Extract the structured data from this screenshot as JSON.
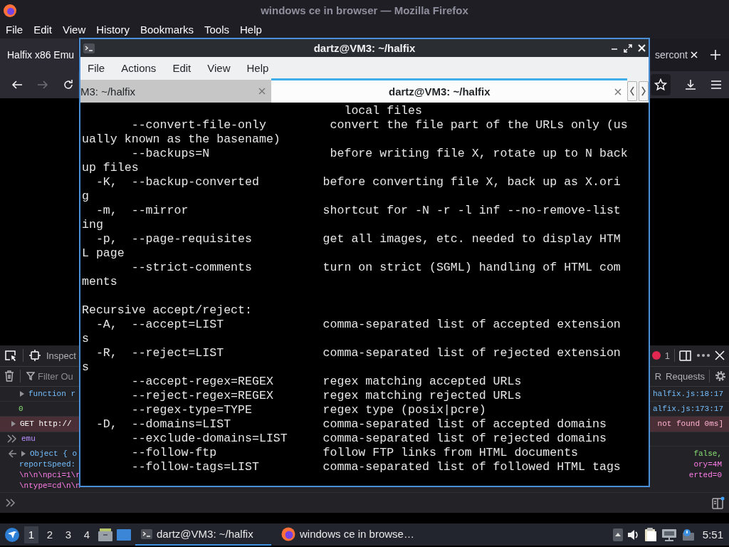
{
  "firefox": {
    "title": "windows ce in browser — Mozilla Firefox",
    "menu": [
      "File",
      "Edit",
      "View",
      "History",
      "Bookmarks",
      "Tools",
      "Help"
    ],
    "tabs": [
      {
        "label": "Halfix x86 Emu",
        "selected": true
      },
      {
        "label": "sercont",
        "selected": false
      }
    ]
  },
  "devtools": {
    "tool": "Inspect",
    "error_count": "1",
    "filter": {
      "placeholder": "Filter Ou"
    },
    "filter_tabs": [
      "R",
      "Requests"
    ],
    "console": [
      {
        "kind": "log",
        "text": "function r",
        "source": "halfix.js:18:17"
      },
      {
        "kind": "number",
        "text": "0",
        "source": "alfix.js:173:17"
      },
      {
        "kind": "error",
        "text": "GET http://",
        "source": "not found 0ms]"
      },
      {
        "kind": "input",
        "text": "emu"
      },
      {
        "kind": "output",
        "lines": [
          {
            "text": "Object { o",
            "tail": "false,"
          },
          {
            "text": "reportSpeed:",
            "tail": "ory=4M"
          },
          {
            "text": "\\n\\n\\npci=1\\r",
            "tail": "erted=0"
          },
          {
            "text": "\\ntype=cd\\n\\n"
          }
        ]
      }
    ]
  },
  "terminal": {
    "title": "dartz@VM3: ~/halfix",
    "menu": [
      "File",
      "Actions",
      "Edit",
      "View",
      "Help"
    ],
    "tabs": [
      {
        "label": "M3: ~/halfix",
        "selected": false
      },
      {
        "label": "dartz@VM3: ~/halfix",
        "selected": true
      }
    ],
    "blocks": [
      [
        "                                     local files",
        "       --convert-file-only         convert the file part of the URLs only (us",
        "ually known as the basename)",
        "       --backups=N                 before writing file X, rotate up to N back",
        "up files",
        "  -K,  --backup-converted         before converting file X, back up as X.ori",
        "g",
        "  -m,  --mirror                   shortcut for -N -r -l inf --no-remove-list",
        "ing",
        "  -p,  --page-requisites          get all images, etc. needed to display HTM",
        "L page",
        "       --strict-comments          turn on strict (SGML) handling of HTML com",
        "ments"
      ],
      [
        "Recursive accept/reject:",
        "  -A,  --accept=LIST              comma-separated list of accepted extension",
        "s",
        "  -R,  --reject=LIST              comma-separated list of rejected extension",
        "s",
        "       --accept-regex=REGEX       regex matching accepted URLs",
        "       --reject-regex=REGEX       regex matching rejected URLs",
        "       --regex-type=TYPE          regex type (posix|pcre)",
        "  -D,  --domains=LIST             comma-separated list of accepted domains",
        "       --exclude-domains=LIST     comma-separated list of rejected domains",
        "       --follow-ftp               follow FTP links from HTML documents",
        "       --follow-tags=LIST         comma-separated list of followed HTML tags"
      ]
    ]
  },
  "taskbar": {
    "workspaces": [
      {
        "label": "1",
        "selected": true
      },
      {
        "label": "2",
        "selected": false
      },
      {
        "label": "3",
        "selected": false
      },
      {
        "label": "4",
        "selected": false
      }
    ],
    "tasks": [
      {
        "kind": "terminal",
        "label": "dartz@VM3: ~/halfix",
        "selected": true
      },
      {
        "kind": "browser",
        "label": "windows ce in browse…",
        "selected": false
      }
    ],
    "clock": "5:51"
  }
}
